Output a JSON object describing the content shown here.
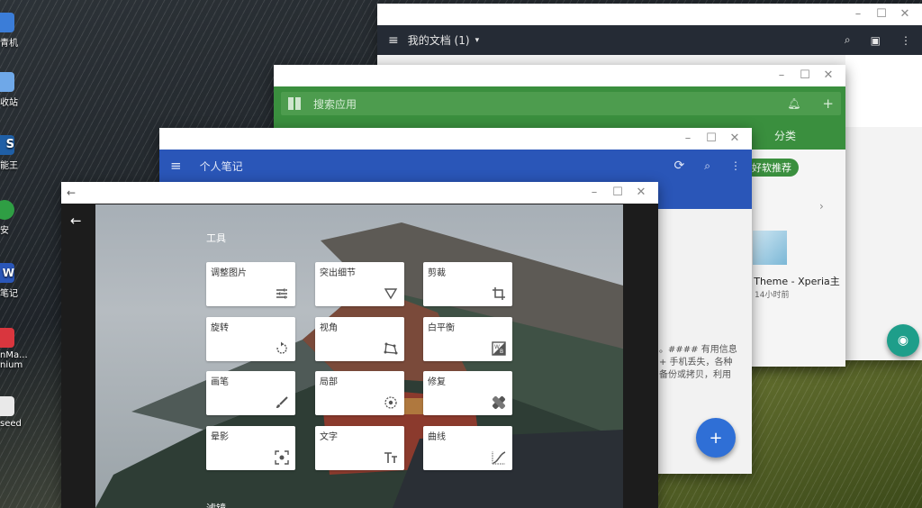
{
  "desktop": {
    "icons": [
      {
        "label": "青机",
        "color": "#3b7dd8"
      },
      {
        "label": "收站",
        "color": "#3b7dd8"
      },
      {
        "label": "能王",
        "color": "#1f5fa6"
      },
      {
        "label": "安",
        "color": "#2f9e44"
      },
      {
        "label": "笔记",
        "color": "#2a56b8"
      },
      {
        "label": "nMa... nium",
        "color": "#d9363e"
      },
      {
        "label": "seed",
        "color": "#e9e9e9"
      }
    ]
  },
  "docs_window": {
    "title": "我的文档 (1)",
    "dropdown": "▾"
  },
  "store_window": {
    "search_placeholder": "搜索应用",
    "tab_category": "分类",
    "chip": "好软推荐",
    "item_title": "s Theme - Xperia主",
    "item_time": "14小时前"
  },
  "notes_window": {
    "title": "个人笔记",
    "snippet": [
      "。#### 有用信息",
      "+ 手机丢失，各种",
      "备份或拷贝，利用"
    ]
  },
  "editor_window": {
    "section_tools": "工具",
    "section_filters": "滤镜",
    "tools": [
      {
        "label": "调整图片",
        "icon": "tune-icon"
      },
      {
        "label": "突出细节",
        "icon": "details-icon"
      },
      {
        "label": "剪裁",
        "icon": "crop-icon"
      },
      {
        "label": "旋转",
        "icon": "rotate-icon"
      },
      {
        "label": "视角",
        "icon": "perspective-icon"
      },
      {
        "label": "白平衡",
        "icon": "white-balance-icon"
      },
      {
        "label": "画笔",
        "icon": "brush-icon"
      },
      {
        "label": "局部",
        "icon": "selective-icon"
      },
      {
        "label": "修复",
        "icon": "healing-icon"
      },
      {
        "label": "晕影",
        "icon": "vignette-icon"
      },
      {
        "label": "文字",
        "icon": "text-icon"
      },
      {
        "label": "曲线",
        "icon": "curves-icon"
      }
    ]
  },
  "colors": {
    "docs_bar": "#252b35",
    "store_green": "#3a8f3e",
    "notes_blue": "#2a56b8",
    "fab_blue": "#2f6fd6",
    "fab_teal": "#1e9e8a"
  }
}
